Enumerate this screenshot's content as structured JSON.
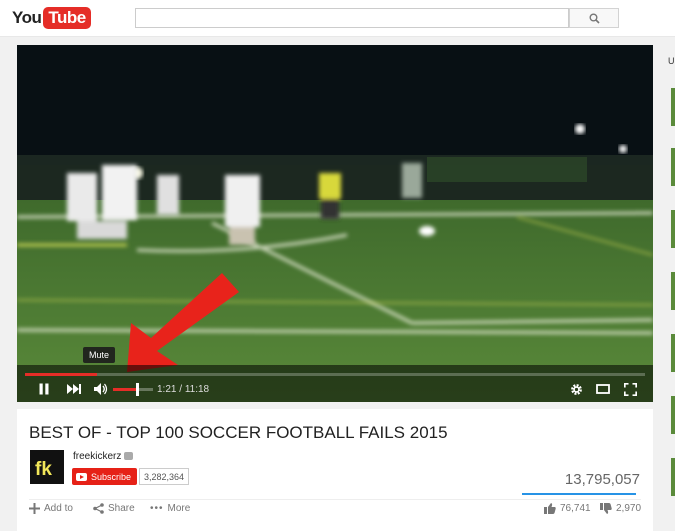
{
  "header": {
    "logo_you": "You",
    "logo_tube": "Tube",
    "search_placeholder": ""
  },
  "player": {
    "progress_fraction": 0.1157,
    "current_time": "1:21",
    "duration": "11:18",
    "tooltip": "Mute",
    "volume_fraction": 0.6
  },
  "video": {
    "title": "BEST OF - TOP 100 SOCCER FOOTBALL FAILS 2015",
    "channel_name": "freekickerz",
    "avatar_text": "fk",
    "subscribe_label": "Subscribe",
    "subscriber_count": "3,282,364",
    "views": "13,795,057",
    "like_ratio": 0.963
  },
  "actions": {
    "add_to": "Add to",
    "share": "Share",
    "more": "More",
    "likes": "76,741",
    "dislikes": "2,970"
  },
  "sidebar": {
    "label": "U"
  },
  "colors": {
    "brand_red": "#e52d27",
    "subscribe_red": "#e62117",
    "like_blue": "#2793e6",
    "annotation_arrow": "#e8231b"
  }
}
